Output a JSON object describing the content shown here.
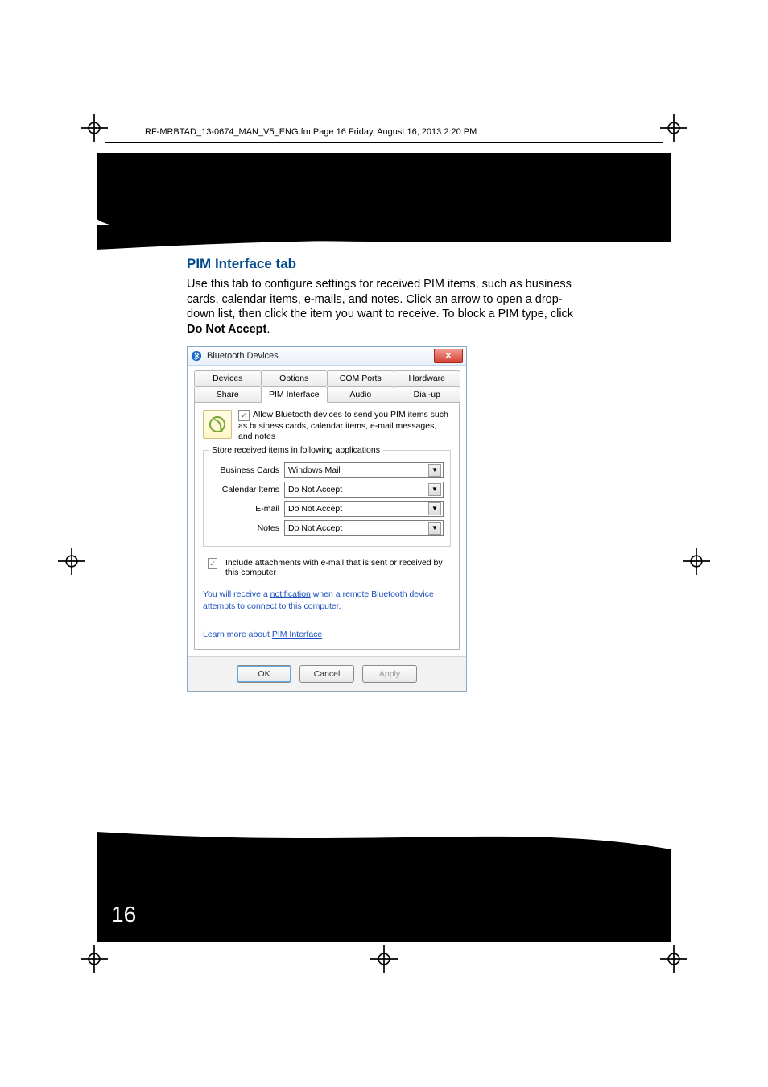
{
  "print_header": "RF-MRBTAD_13-0674_MAN_V5_ENG.fm  Page 16  Friday, August 16, 2013  2:20 PM",
  "page_number": "16",
  "section": {
    "heading": "PIM Interface tab",
    "body_pre": "Use this tab to configure settings for received PIM items, such as business cards, calendar items, e-mails, and notes. Click an arrow to open a drop-down list, then click the item you want to receive. To block a PIM type, click ",
    "body_bold": "Do Not Accept",
    "body_post": "."
  },
  "dialog": {
    "title": "Bluetooth Devices",
    "tabs_row1": [
      "Devices",
      "Options",
      "COM Ports",
      "Hardware"
    ],
    "tabs_row2": [
      "Share",
      "PIM Interface",
      "Audio",
      "Dial-up"
    ],
    "selected_tab": "PIM Interface",
    "allow_text": "Allow Bluetooth devices to send you PIM items such as business cards, calendar items, e-mail messages, and notes",
    "fieldset_legend": "Store received items in following applications",
    "rows": [
      {
        "label": "Business Cards",
        "value": "Windows Mail"
      },
      {
        "label": "Calendar Items",
        "value": "Do Not Accept"
      },
      {
        "label": "E-mail",
        "value": "Do Not Accept"
      },
      {
        "label": "Notes",
        "value": "Do Not Accept"
      }
    ],
    "attach_text": "Include attachments with e-mail that is sent or received by this computer",
    "notif_pre": "You will receive a ",
    "notif_link": "notification",
    "notif_post": " when a remote Bluetooth device attempts to connect to this computer.",
    "learn_pre": "Learn more about ",
    "learn_link": "PIM Interface",
    "buttons": {
      "ok": "OK",
      "cancel": "Cancel",
      "apply": "Apply"
    }
  }
}
